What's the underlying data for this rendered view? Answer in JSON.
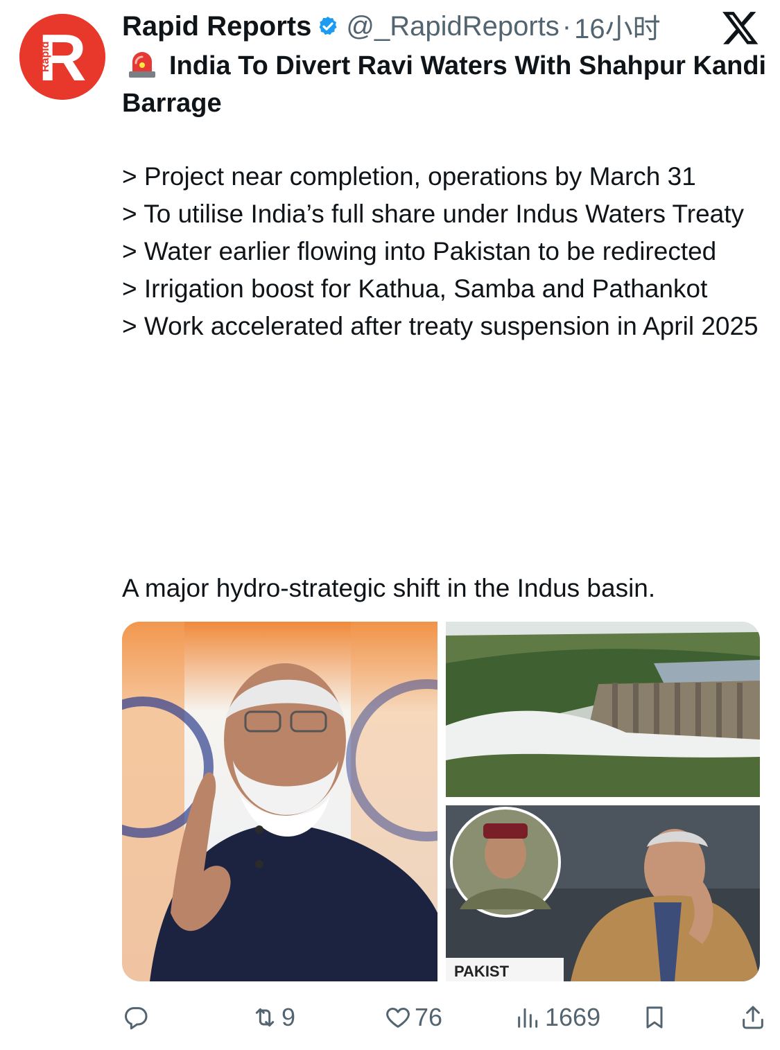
{
  "tweet": {
    "display_name": "Rapid Reports",
    "handle": "@_RapidReports",
    "separator": "·",
    "time": "16小时",
    "avatar_text": "Rapid",
    "avatar_letter": "R",
    "headline": "India To Divert Ravi Waters With Shahpur Kandi Barrage",
    "bullets": [
      "> Project near completion, operations by March 31",
      "> To utilise India’s full share under Indus Waters Treaty",
      "> Water earlier flowing into Pakistan to be redirected",
      "> Irrigation boost for Kathua, Samba and Pathankot",
      "> Work accelerated after treaty suspension in April 2025"
    ],
    "closing": "A major hydro-strategic shift in the Indus basin.",
    "media_caption_text": "PAKIST"
  },
  "actions": {
    "retweets": "9",
    "likes": "76",
    "views": "1669"
  },
  "colors": {
    "text": "#0f1419",
    "secondary": "#536471",
    "verified": "#1d9bf0",
    "avatar_bg": "#e8372b"
  },
  "icons": [
    "verified-badge-icon",
    "x-logo-icon",
    "siren-icon",
    "reply-icon",
    "retweet-icon",
    "like-icon",
    "views-icon",
    "bookmark-icon",
    "share-icon"
  ]
}
